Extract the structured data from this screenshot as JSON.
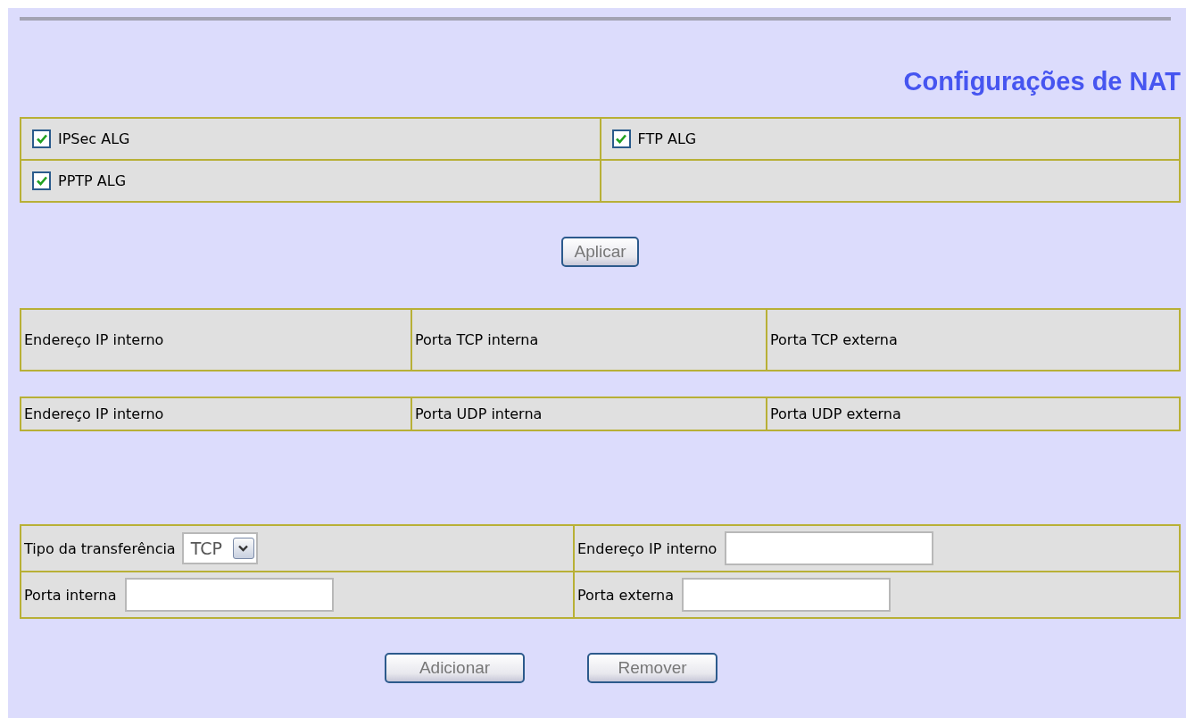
{
  "title": "Configurações de NAT",
  "alg_options": [
    {
      "label": "IPSec ALG",
      "checked": true
    },
    {
      "label": "FTP ALG",
      "checked": true
    },
    {
      "label": "PPTP ALG",
      "checked": true
    }
  ],
  "apply_button": "Aplicar",
  "tcp_table": {
    "columns": [
      "Endereço IP interno",
      "Porta TCP interna",
      "Porta TCP externa"
    ]
  },
  "udp_table": {
    "columns": [
      "Endereço IP interno",
      "Porta UDP interna",
      "Porta UDP externa"
    ]
  },
  "form": {
    "transfer_type": {
      "label": "Tipo da transferência",
      "value": "TCP"
    },
    "internal_ip": {
      "label": "Endereço  IP interno"
    },
    "internal_port": {
      "label": "Porta interna"
    },
    "external_port": {
      "label": "Porta externa"
    }
  },
  "buttons": [
    "Adicionar",
    "Remover"
  ]
}
